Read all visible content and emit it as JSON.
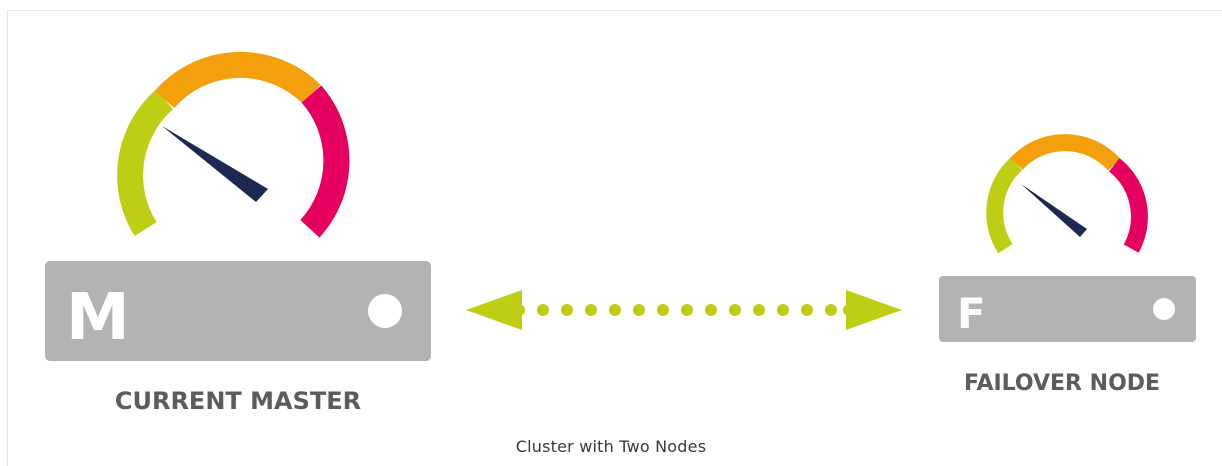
{
  "diagram": {
    "master": {
      "letter": "M",
      "label": "CURRENT MASTER"
    },
    "failover": {
      "letter": "F",
      "label": "FAILOVER NODE"
    },
    "caption": "Cluster with Two Nodes"
  },
  "colors": {
    "gauge_green": "#bfcd14",
    "gauge_orange": "#f4a00c",
    "gauge_pink": "#e5005f",
    "needle": "#1d2952",
    "server": "#b3b3b3",
    "arrow": "#bfcd14",
    "label": "#5c5c5c"
  },
  "icons": [
    "gauge-icon",
    "needle-icon",
    "server-icon",
    "status-light-icon",
    "bidirectional-arrow-icon"
  ]
}
